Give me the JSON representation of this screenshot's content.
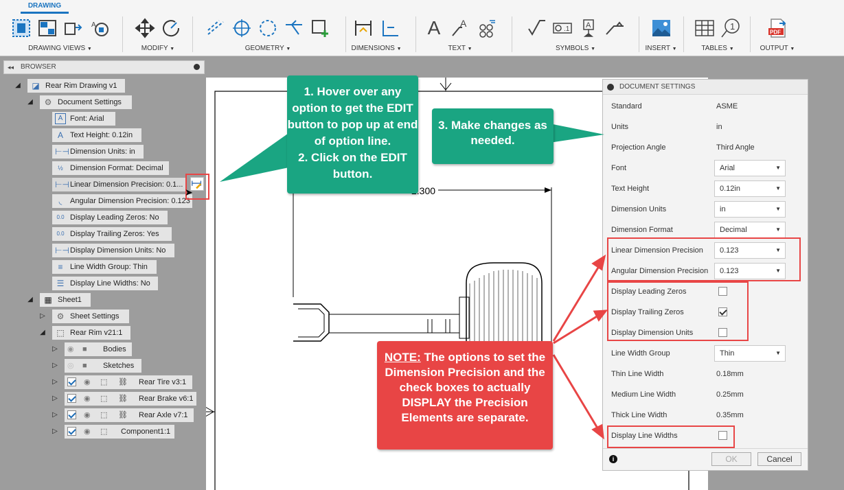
{
  "ribbon": {
    "tab": "DRAWING",
    "groups": [
      "DRAWING VIEWS",
      "MODIFY",
      "GEOMETRY",
      "DIMENSIONS",
      "TEXT",
      "SYMBOLS",
      "INSERT",
      "TABLES",
      "OUTPUT"
    ],
    "arrow": "▼",
    "pdf_text": "PDF"
  },
  "browser": {
    "title": "BROWSER",
    "root": "Rear Rim Drawing v1",
    "doc_settings": "Document Settings",
    "items": [
      "Font: Arial",
      "Text Height: 0.12in",
      "Dimension Units: in",
      "Dimension Format: Decimal",
      "Linear Dimension Precision: 0.1...",
      "Angular Dimension Precision: 0.123",
      "Display Leading Zeros: No",
      "Display Trailing Zeros: Yes",
      "Display Dimension Units: No",
      "Line Width Group: Thin",
      "Display Line Widths: No"
    ],
    "sheet": "Sheet1",
    "sheet_settings": "Sheet Settings",
    "component": "Rear Rim v21:1",
    "bodies": "Bodies",
    "sketches": "Sketches",
    "children": [
      "Rear Tire v3:1",
      "Rear Brake v6:1",
      "Rear Axle v7:1",
      "Component1:1"
    ]
  },
  "canvas": {
    "dimension_value": "2.300"
  },
  "settings": {
    "title": "DOCUMENT SETTINGS",
    "standard_label": "Standard",
    "standard_value": "ASME",
    "units_label": "Units",
    "units_value": "in",
    "projection_label": "Projection Angle",
    "projection_value": "Third Angle",
    "font_label": "Font",
    "font_value": "Arial",
    "text_height_label": "Text Height",
    "text_height_value": "0.12in",
    "dim_units_label": "Dimension Units",
    "dim_units_value": "in",
    "dim_format_label": "Dimension Format",
    "dim_format_value": "Decimal",
    "linear_label": "Linear Dimension Precision",
    "linear_value": "0.123",
    "angular_label": "Angular Dimension Precision",
    "angular_value": "0.123",
    "leading_label": "Display Leading Zeros",
    "leading_checked": false,
    "trailing_label": "Display Trailing Zeros",
    "trailing_checked": true,
    "dunits_label": "Display Dimension Units",
    "dunits_checked": false,
    "lwgroup_label": "Line Width Group",
    "lwgroup_value": "Thin",
    "thin_label": "Thin Line Width",
    "thin_value": "0.18mm",
    "medium_label": "Medium Line Width",
    "medium_value": "0.25mm",
    "thick_label": "Thick Line Width",
    "thick_value": "0.35mm",
    "dlw_label": "Display Line Widths",
    "dlw_checked": false,
    "ok": "OK",
    "cancel": "Cancel"
  },
  "callouts": {
    "c1": "1. Hover over any option to get the EDIT button to pop up at end of option line.\n2. Click on the EDIT button.",
    "c3": "3. Make changes as needed.",
    "note_prefix": "NOTE:",
    "note_body": " The options to set the Dimension Precision and the check boxes to actually DISPLAY the Precision Elements are separate."
  },
  "colors": {
    "teal": "#1aa582",
    "red": "#e84545",
    "accent": "#1a74c0"
  }
}
